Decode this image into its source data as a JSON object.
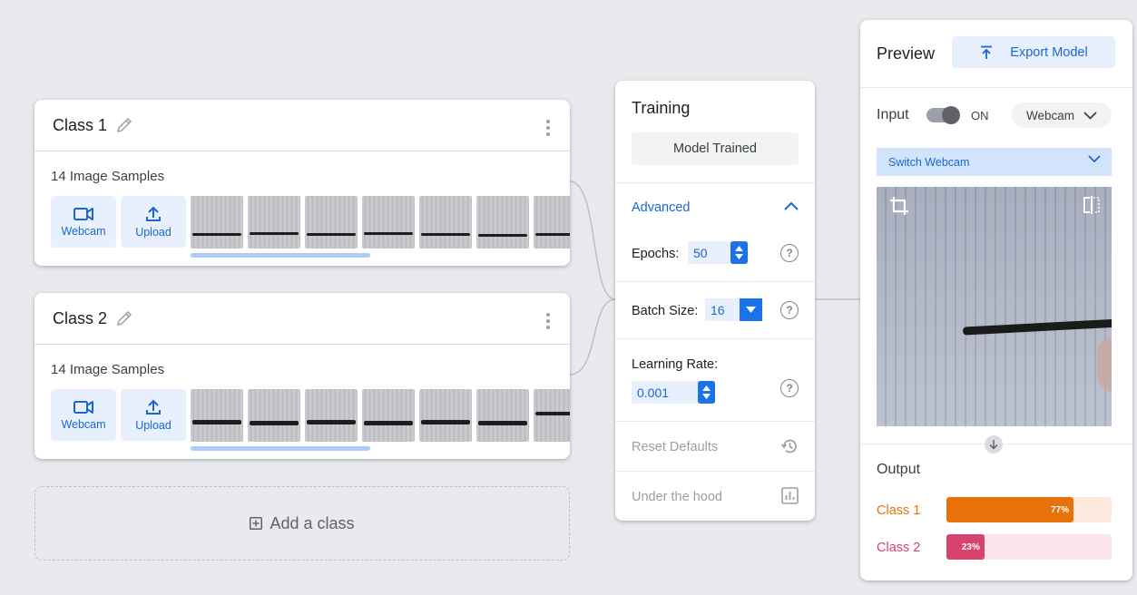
{
  "classes": [
    {
      "name": "Class 1",
      "samples": "14 Image Samples",
      "webcam_label": "Webcam",
      "upload_label": "Upload"
    },
    {
      "name": "Class 2",
      "samples": "14 Image Samples",
      "webcam_label": "Webcam",
      "upload_label": "Upload"
    }
  ],
  "add_class_label": "Add a class",
  "training": {
    "title": "Training",
    "status_button": "Model Trained",
    "advanced_label": "Advanced",
    "epochs_label": "Epochs:",
    "epochs_value": "50",
    "batch_label": "Batch Size:",
    "batch_value": "16",
    "lr_label": "Learning Rate:",
    "lr_value": "0.001",
    "reset_label": "Reset Defaults",
    "hood_label": "Under the hood",
    "help_glyph": "?"
  },
  "preview": {
    "title": "Preview",
    "export_label": "Export Model",
    "input_label": "Input",
    "toggle_state": "ON",
    "source_select": "Webcam",
    "switch_webcam": "Switch Webcam",
    "output_label": "Output",
    "outputs": [
      {
        "label": "Class 1",
        "percent": 77,
        "percent_text": "77%",
        "color": "#e8710a",
        "track": "#fde8de"
      },
      {
        "label": "Class 2",
        "percent": 23,
        "percent_text": "23%",
        "color": "#d7436d",
        "track": "#fce4ec"
      }
    ]
  },
  "colors": {
    "accent": "#1a73e8",
    "accent_text": "#1967d2",
    "accent_light": "#e8f0fe"
  }
}
